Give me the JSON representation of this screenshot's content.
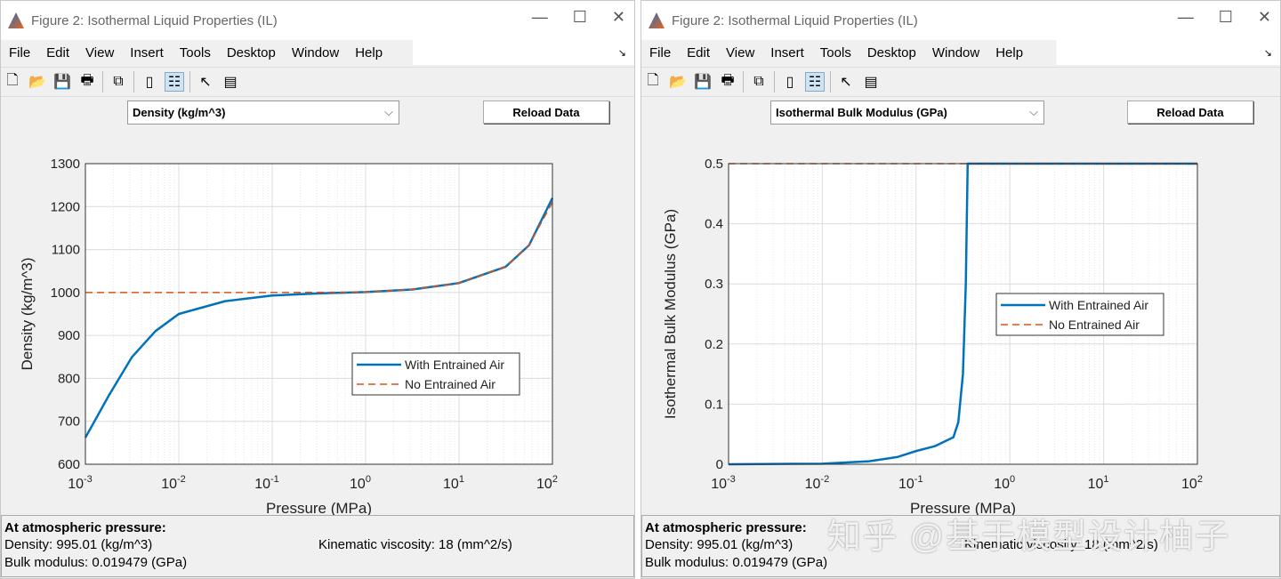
{
  "windows": [
    {
      "title": "Figure 2: Isothermal Liquid Properties (IL)",
      "menu": [
        "File",
        "Edit",
        "View",
        "Insert",
        "Tools",
        "Desktop",
        "Window",
        "Help"
      ],
      "dropdown": "Density (kg/m^3)",
      "reload": "Reload Data",
      "info": {
        "heading": "At atmospheric pressure:",
        "density": "Density: 995.01 (kg/m^3)",
        "bulk": "Bulk modulus: 0.019479 (GPa)",
        "visc": "Kinematic viscosity: 18 (mm^2/s)"
      }
    },
    {
      "title": "Figure 2: Isothermal Liquid Properties (IL)",
      "menu": [
        "File",
        "Edit",
        "View",
        "Insert",
        "Tools",
        "Desktop",
        "Window",
        "Help"
      ],
      "dropdown": "Isothermal Bulk Modulus (GPa)",
      "reload": "Reload Data",
      "info": {
        "heading": "At atmospheric pressure:",
        "density": "Density: 995.01 (kg/m^3)",
        "bulk": "Bulk modulus: 0.019479 (GPa)",
        "visc": "Kinematic viscosity: 18 (mm^2/s)"
      }
    }
  ],
  "watermark": "知乎 @基于模型设计柚子",
  "colors": {
    "with_air": "#0072bd",
    "no_air": "#d95319"
  },
  "chart_data": [
    {
      "type": "line",
      "xscale": "log",
      "xlabel": "Pressure (MPa)",
      "ylabel": "Density (kg/m^3)",
      "xlim": [
        0.001,
        100
      ],
      "ylim": [
        600,
        1300
      ],
      "yticks": [
        600,
        700,
        800,
        900,
        1000,
        1100,
        1200,
        1300
      ],
      "xticks": [
        "10^-3",
        "10^-2",
        "10^-1",
        "10^0",
        "10^1",
        "10^2"
      ],
      "grid": true,
      "legend": "center-right",
      "series": [
        {
          "name": "With Entrained Air",
          "style": "solid",
          "x": [
            0.001,
            0.00178,
            0.00316,
            0.00562,
            0.01,
            0.0316,
            0.1,
            0.316,
            1,
            3.16,
            10,
            31.6,
            56.2,
            100
          ],
          "y": [
            662,
            760,
            850,
            910,
            950,
            980,
            993,
            998,
            1001,
            1007,
            1022,
            1060,
            1110,
            1220
          ]
        },
        {
          "name": "No Entrained Air",
          "style": "dashed",
          "x": [
            0.001,
            0.01,
            0.1,
            1,
            3.16,
            10,
            31.6,
            56.2,
            100
          ],
          "y": [
            1000,
            1000,
            1000,
            1001,
            1007,
            1022,
            1060,
            1110,
            1210
          ]
        }
      ]
    },
    {
      "type": "line",
      "xscale": "log",
      "xlabel": "Pressure (MPa)",
      "ylabel": "Isothermal Bulk Modulus (GPa)",
      "xlim": [
        0.001,
        100
      ],
      "ylim": [
        0,
        0.5
      ],
      "yticks": [
        0,
        0.1,
        0.2,
        0.3,
        0.4,
        0.5
      ],
      "xticks": [
        "10^-3",
        "10^-2",
        "10^-1",
        "10^0",
        "10^1",
        "10^2"
      ],
      "grid": true,
      "legend": "center-right",
      "series": [
        {
          "name": "With Entrained Air",
          "style": "solid",
          "x": [
            0.001,
            0.01,
            0.0316,
            0.063,
            0.1,
            0.158,
            0.25,
            0.282,
            0.316,
            0.339,
            0.355,
            100
          ],
          "y": [
            0,
            0.001,
            0.005,
            0.012,
            0.022,
            0.03,
            0.045,
            0.07,
            0.15,
            0.3,
            0.5,
            0.5
          ]
        },
        {
          "name": "No Entrained Air",
          "style": "dashed",
          "x": [
            0.001,
            100
          ],
          "y": [
            0.5,
            0.5
          ]
        }
      ]
    }
  ]
}
